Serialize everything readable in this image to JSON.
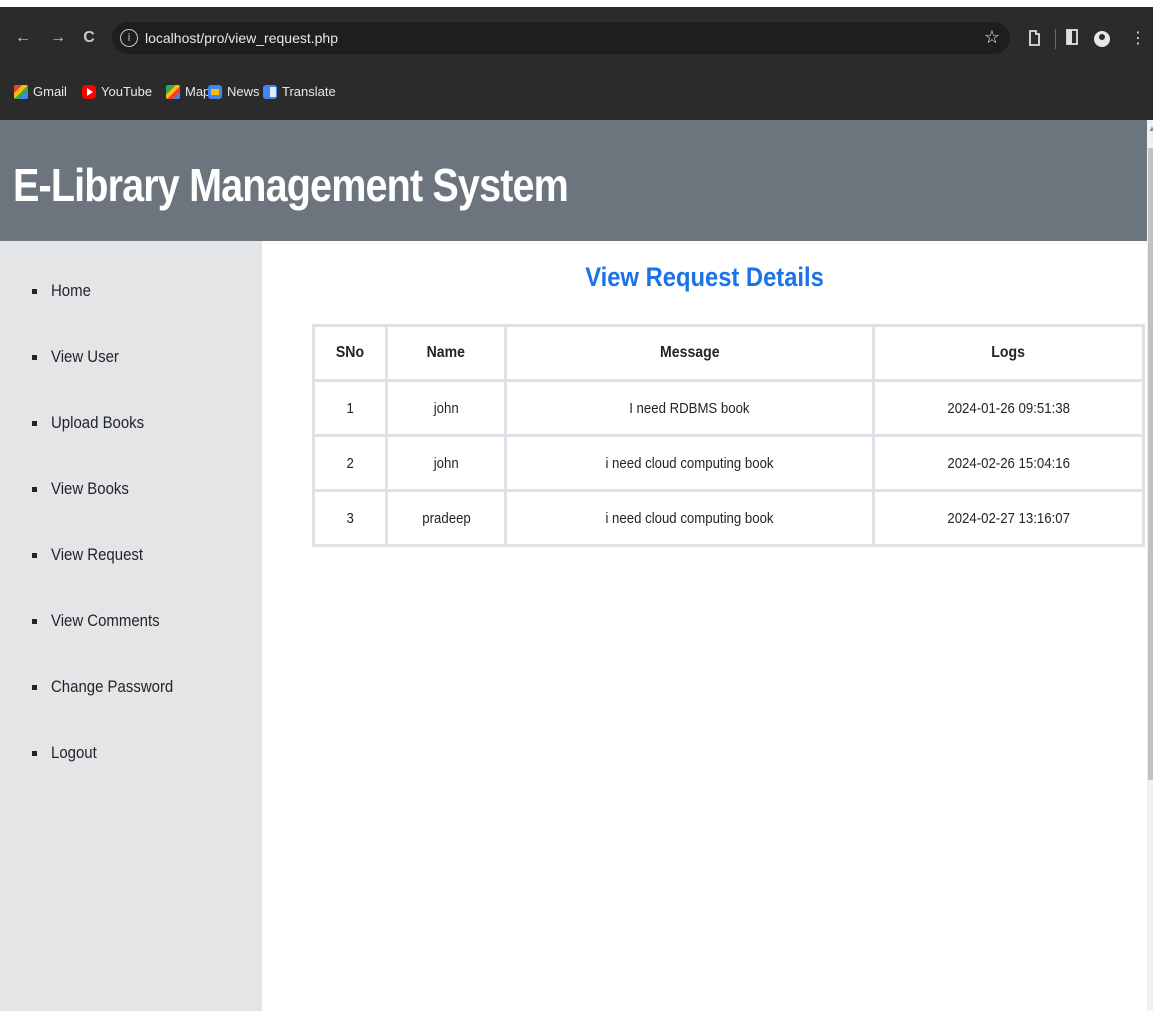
{
  "browser": {
    "url": "localhost/pro/view_request.php",
    "bookmarks": [
      {
        "label": "Gmail",
        "icon": "gmail-icon"
      },
      {
        "label": "YouTube",
        "icon": "youtube-icon"
      },
      {
        "label": "Maps",
        "icon": "maps-icon"
      },
      {
        "label": "News",
        "icon": "news-icon"
      },
      {
        "label": "Translate",
        "icon": "translate-icon"
      }
    ],
    "icons": {
      "back": "←",
      "forward": "→",
      "reload": "C",
      "info": "i",
      "star": "☆",
      "extensions": "extensions-icon",
      "sidepanel": "sidepanel-icon",
      "menu": "⋮"
    }
  },
  "header": {
    "title": "E-Library Management System",
    "background": "#6c757d"
  },
  "sidebar": {
    "items": [
      {
        "label": "Home"
      },
      {
        "label": "View User"
      },
      {
        "label": "Upload Books"
      },
      {
        "label": "View Books"
      },
      {
        "label": "View Request"
      },
      {
        "label": "View Comments"
      },
      {
        "label": "Change Password"
      },
      {
        "label": "Logout"
      }
    ]
  },
  "main": {
    "title": "View Request Details",
    "title_color": "#1a73e8",
    "table": {
      "columns": [
        "SNo",
        "Name",
        "Message",
        "Logs"
      ],
      "rows": [
        {
          "sno": "1",
          "name": "john",
          "message": "I need RDBMS book",
          "logs": "2024-01-26 09:51:38"
        },
        {
          "sno": "2",
          "name": "john",
          "message": "i need cloud computing book",
          "logs": "2024-02-26 15:04:16"
        },
        {
          "sno": "3",
          "name": "pradeep",
          "message": "i need cloud computing book",
          "logs": "2024-02-27 13:16:07"
        }
      ]
    }
  }
}
